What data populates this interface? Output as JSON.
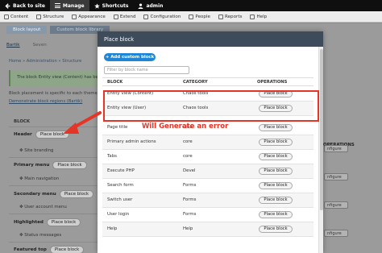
{
  "toolbar": {
    "back_label": "Back to site",
    "manage_label": "Manage",
    "shortcuts_label": "Shortcuts",
    "user_label": "admin"
  },
  "admin_menu": {
    "items": [
      "Content",
      "Structure",
      "Appearance",
      "Extend",
      "Configuration",
      "People",
      "Reports",
      "Help"
    ]
  },
  "background": {
    "tabs": [
      "Block layout",
      "Custom block library"
    ],
    "subtabs": [
      "Bartik",
      "Seven"
    ],
    "breadcrumb": "Home » Administration » Structure",
    "message": "The block Entity view (Content) has be",
    "note": "Block placement is specific to each theme on",
    "demo_link": "Demonstrate block regions (Bartik)",
    "block_header": "BLOCK",
    "operations_header": "OPERATIONS",
    "place_block_label": "Place block",
    "configure_label": "nfigure",
    "regions": [
      {
        "name": "Header",
        "row": "Site branding"
      },
      {
        "name": "Primary menu",
        "row": "Main navigation"
      },
      {
        "name": "Secondary menu",
        "row": "User account menu"
      },
      {
        "name": "Highlighted",
        "row": "Status messages"
      },
      {
        "name": "Featured top",
        "row": ""
      }
    ]
  },
  "dialog": {
    "title": "Place block",
    "add_button": "+ Add custom block",
    "filter_placeholder": "Filter by block name",
    "columns": [
      "BLOCK",
      "CATEGORY",
      "OPERATIONS"
    ],
    "place_label": "Place block",
    "rows": [
      {
        "block": "Entity view (Content)",
        "category": "Chaos tools"
      },
      {
        "block": "Entity view (User)",
        "category": "Chaos tools"
      },
      {
        "block": "Page title",
        "category": "core"
      },
      {
        "block": "Primary admin actions",
        "category": "core"
      },
      {
        "block": "Tabs",
        "category": "core"
      },
      {
        "block": "Execute PHP",
        "category": "Devel"
      },
      {
        "block": "Search form",
        "category": "Forms"
      },
      {
        "block": "Switch user",
        "category": "Forms"
      },
      {
        "block": "User login",
        "category": "Forms"
      },
      {
        "block": "Help",
        "category": "Help"
      }
    ]
  },
  "annotation": {
    "text": "Will Generate an error",
    "color": "#e53527"
  },
  "colors": {
    "toolbar_bg": "#0f0f0f",
    "dialog_title_bg": "#3d4b5b",
    "add_button": "#1f85d6"
  }
}
